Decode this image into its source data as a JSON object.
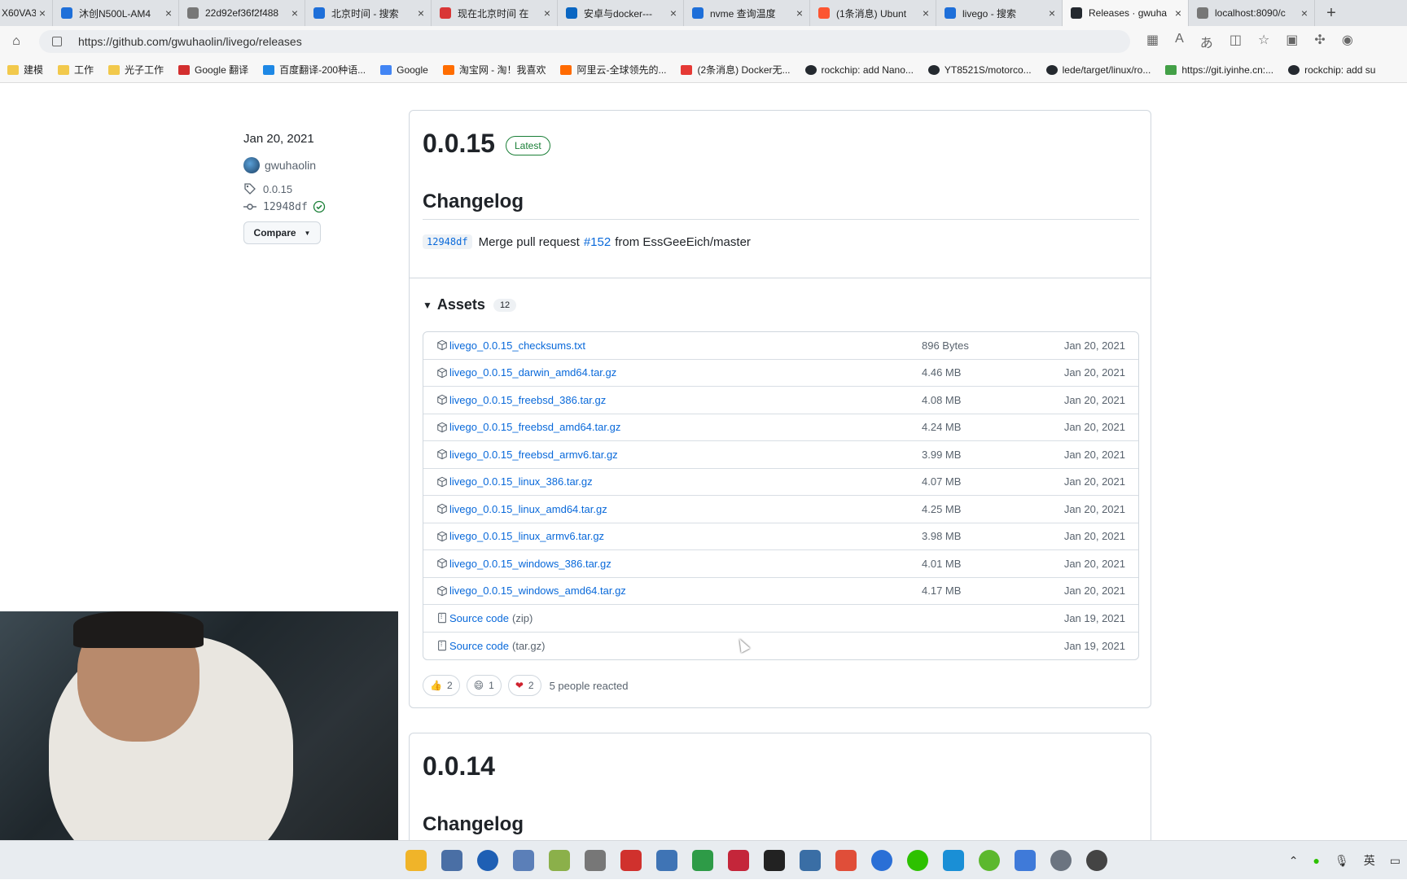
{
  "browser": {
    "tabs": [
      {
        "title": "X60VA3",
        "icon": "page-icon"
      },
      {
        "title": "沐创N500L-AM4",
        "icon": "search-icon"
      },
      {
        "title": "22d92ef36f2f488",
        "icon": "page-icon"
      },
      {
        "title": "北京时间 - 搜索",
        "icon": "search-icon"
      },
      {
        "title": "现在北京时间 在",
        "icon": "clock-icon"
      },
      {
        "title": "安卓与docker---",
        "icon": "zhihu-icon"
      },
      {
        "title": "nvme 查询温度",
        "icon": "search-icon"
      },
      {
        "title": "(1条消息) Ubunt",
        "icon": "csdn-icon"
      },
      {
        "title": "livego - 搜索",
        "icon": "search-icon"
      },
      {
        "title": "Releases · gwuha",
        "icon": "github-icon"
      },
      {
        "title": "localhost:8090/c",
        "icon": "page-icon"
      }
    ],
    "url": "https://github.com/gwuhaolin/livego/releases",
    "bookmarks": [
      "建模",
      "工作",
      "光子工作",
      "Google 翻译",
      "百度翻译-200种语...",
      "Google",
      "淘宝网 - 淘！我喜欢",
      "阿里云-全球领先的...",
      "(2条消息) Docker无...",
      "rockchip: add Nano...",
      "YT8521S/motorco...",
      "lede/target/linux/ro...",
      "https://git.iyinhe.cn:...",
      "rockchip: add su"
    ]
  },
  "sidebar": {
    "date": "Jan 20, 2021",
    "author": "gwuhaolin",
    "tag": "0.0.15",
    "commit": "12948df",
    "compare_label": "Compare"
  },
  "release": {
    "version": "0.0.15",
    "badge": "Latest",
    "changelog_title": "Changelog",
    "commit_sha": "12948df",
    "commit_text_before": "Merge pull request",
    "pr_link": "#152",
    "commit_text_after": "from EssGeeEich/master",
    "assets_title": "Assets",
    "assets_count": "12",
    "assets": [
      {
        "name": "livego_0.0.15_checksums.txt",
        "size": "896 Bytes",
        "date": "Jan 20, 2021",
        "kind": "package"
      },
      {
        "name": "livego_0.0.15_darwin_amd64.tar.gz",
        "size": "4.46 MB",
        "date": "Jan 20, 2021",
        "kind": "package"
      },
      {
        "name": "livego_0.0.15_freebsd_386.tar.gz",
        "size": "4.08 MB",
        "date": "Jan 20, 2021",
        "kind": "package"
      },
      {
        "name": "livego_0.0.15_freebsd_amd64.tar.gz",
        "size": "4.24 MB",
        "date": "Jan 20, 2021",
        "kind": "package"
      },
      {
        "name": "livego_0.0.15_freebsd_armv6.tar.gz",
        "size": "3.99 MB",
        "date": "Jan 20, 2021",
        "kind": "package"
      },
      {
        "name": "livego_0.0.15_linux_386.tar.gz",
        "size": "4.07 MB",
        "date": "Jan 20, 2021",
        "kind": "package"
      },
      {
        "name": "livego_0.0.15_linux_amd64.tar.gz",
        "size": "4.25 MB",
        "date": "Jan 20, 2021",
        "kind": "package"
      },
      {
        "name": "livego_0.0.15_linux_armv6.tar.gz",
        "size": "3.98 MB",
        "date": "Jan 20, 2021",
        "kind": "package"
      },
      {
        "name": "livego_0.0.15_windows_386.tar.gz",
        "size": "4.01 MB",
        "date": "Jan 20, 2021",
        "kind": "package"
      },
      {
        "name": "livego_0.0.15_windows_amd64.tar.gz",
        "size": "4.17 MB",
        "date": "Jan 20, 2021",
        "kind": "package"
      },
      {
        "name": "Source code",
        "suffix": "(zip)",
        "size": "",
        "date": "Jan 19, 2021",
        "kind": "zip"
      },
      {
        "name": "Source code",
        "suffix": "(tar.gz)",
        "size": "",
        "date": "Jan 19, 2021",
        "kind": "zip"
      }
    ],
    "reactions": [
      {
        "emoji": "👍",
        "count": "2"
      },
      {
        "emoji": "😄",
        "count": "1"
      },
      {
        "emoji": "❤",
        "count": "2"
      }
    ],
    "reaction_summary": "5 people reacted"
  },
  "release2": {
    "version": "0.0.14",
    "changelog_title": "Changelog"
  },
  "colors": {
    "link": "#0969da",
    "latest": "#1a7f37",
    "border": "#d0d7de"
  }
}
